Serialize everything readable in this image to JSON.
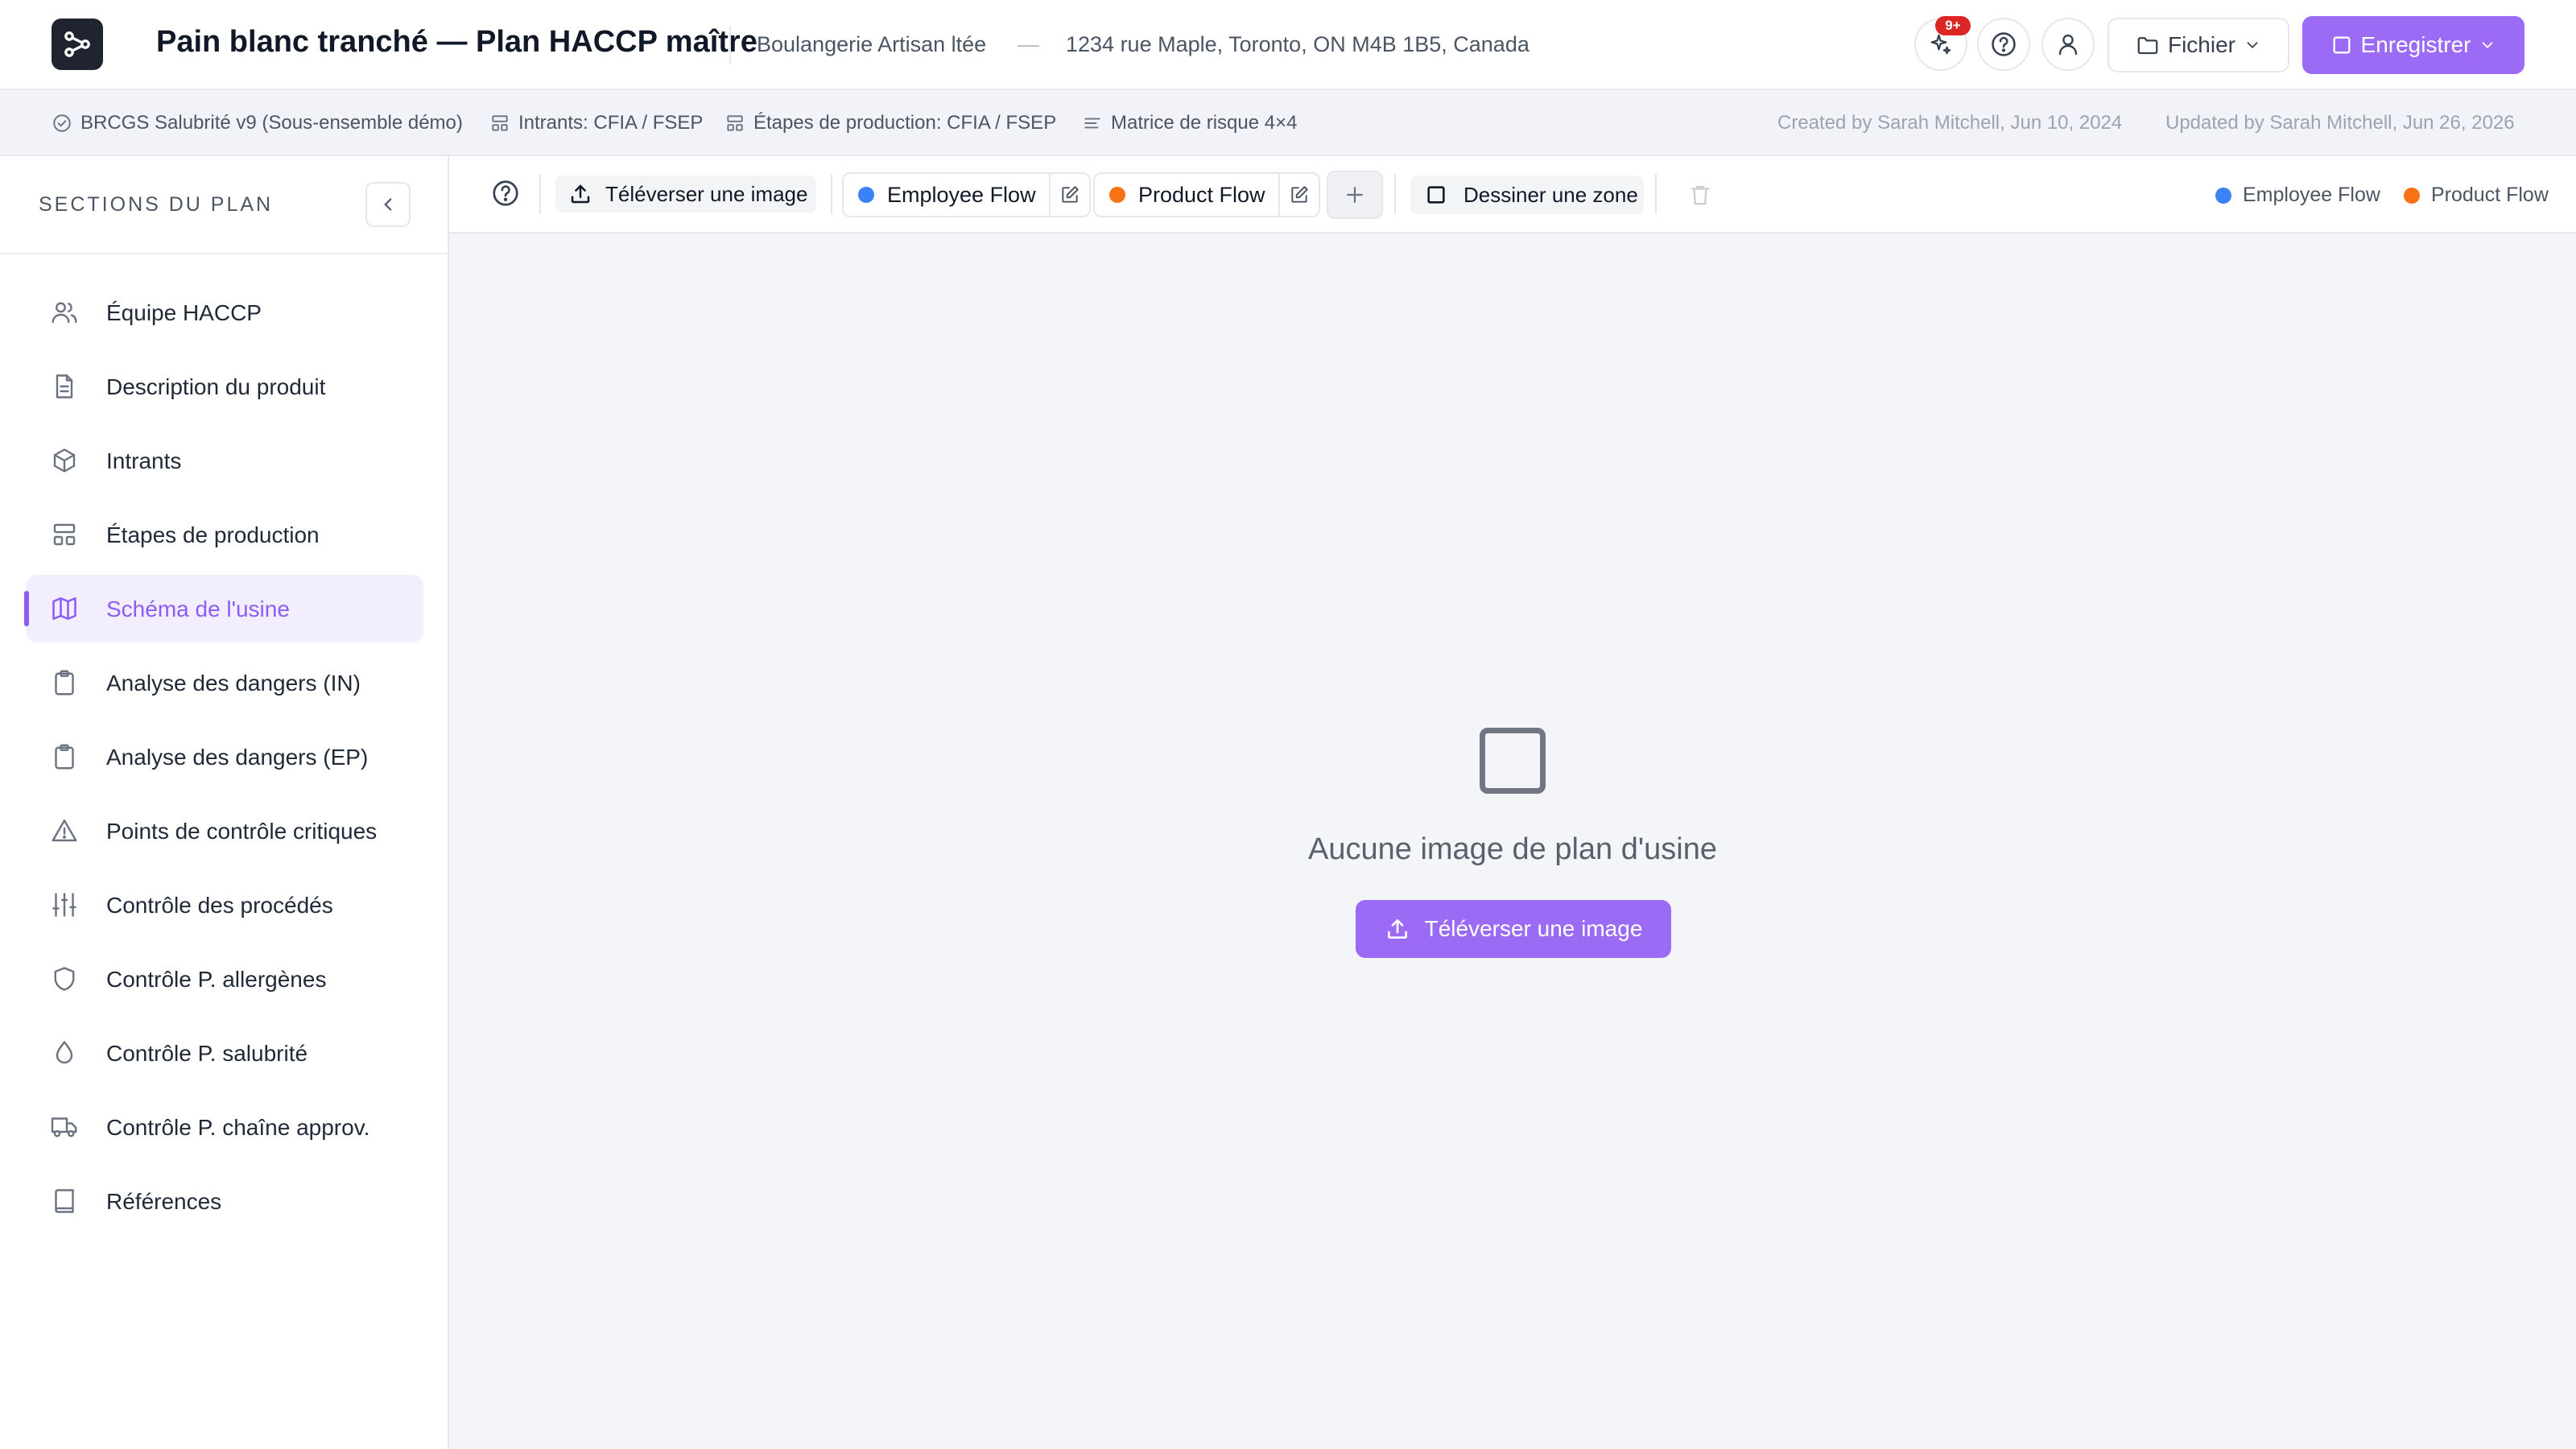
{
  "header": {
    "title": "Pain blanc tranché — Plan HACCP maître",
    "company": "Boulangerie Artisan ltée",
    "separator": "—",
    "address": "1234 rue Maple, Toronto, ON M4B 1B5, Canada",
    "notifications_badge": "9+",
    "file_button": "Fichier",
    "save_button": "Enregistrer",
    "accent_color": "#9b6bf5"
  },
  "infobar": {
    "items": [
      {
        "icon": "check-circle-icon",
        "label": "BRCGS Salubrité v9 (Sous-ensemble démo)"
      },
      {
        "icon": "layout-icon",
        "label": "Intrants: CFIA / FSEP"
      },
      {
        "icon": "layout-icon",
        "label": "Étapes de production: CFIA / FSEP"
      },
      {
        "icon": "list-icon",
        "label": "Matrice de risque 4×4"
      }
    ],
    "created": "Created by Sarah Mitchell, Jun 10, 2024",
    "updated": "Updated by Sarah Mitchell, Jun 26, 2026"
  },
  "sidebar": {
    "title": "SECTIONS DU PLAN",
    "items": [
      {
        "label": "Équipe HACCP",
        "icon": "users-icon"
      },
      {
        "label": "Description du produit",
        "icon": "document-icon"
      },
      {
        "label": "Intrants",
        "icon": "box-icon"
      },
      {
        "label": "Étapes de production",
        "icon": "layout-icon"
      },
      {
        "label": "Schéma de l'usine",
        "icon": "map-icon",
        "active": true
      },
      {
        "label": "Analyse des dangers (IN)",
        "icon": "clipboard-icon"
      },
      {
        "label": "Analyse des dangers (EP)",
        "icon": "clipboard-icon"
      },
      {
        "label": "Points de contrôle critiques",
        "icon": "warning-icon"
      },
      {
        "label": "Contrôle des procédés",
        "icon": "sliders-icon"
      },
      {
        "label": "Contrôle P. allergènes",
        "icon": "shield-icon"
      },
      {
        "label": "Contrôle P. salubrité",
        "icon": "droplet-icon"
      },
      {
        "label": "Contrôle P. chaîne approv.",
        "icon": "truck-icon"
      },
      {
        "label": "Références",
        "icon": "book-icon"
      }
    ]
  },
  "toolbar": {
    "upload_label": "Téléverser une image",
    "flows": [
      {
        "name": "Employee Flow",
        "color": "#3b82f6"
      },
      {
        "name": "Product Flow",
        "color": "#f97316"
      }
    ],
    "draw_zone_label": "Dessiner une zone",
    "legend": [
      {
        "name": "Employee Flow",
        "color": "#3b82f6"
      },
      {
        "name": "Product Flow",
        "color": "#f97316"
      }
    ]
  },
  "canvas": {
    "empty_message": "Aucune image de plan d'usine",
    "upload_button": "Téléverser une image"
  }
}
